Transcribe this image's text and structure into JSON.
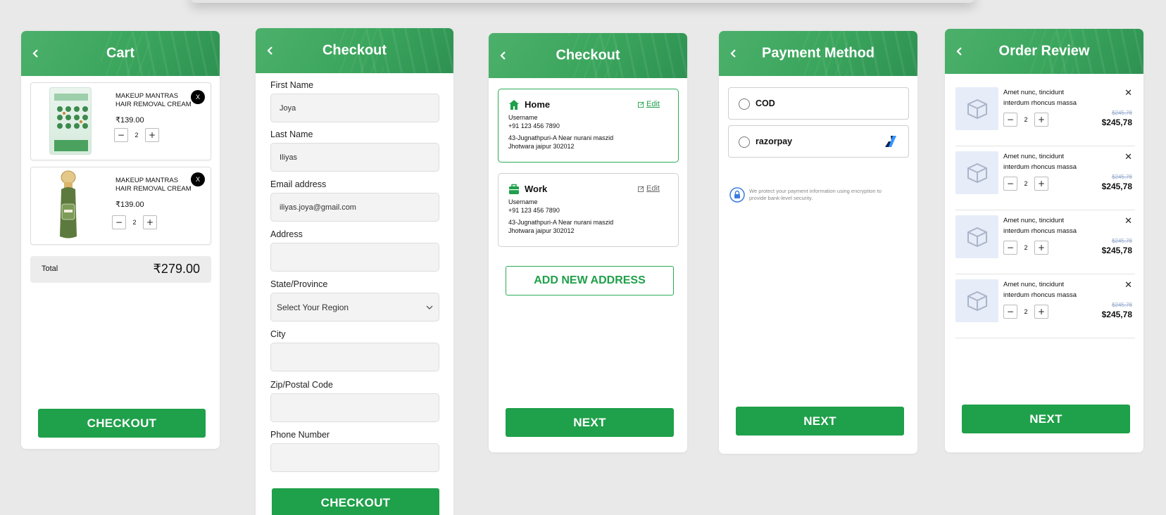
{
  "cart": {
    "title": "Cart",
    "items": [
      {
        "name_line1": "MAKEUP MANTRAS",
        "name_line2": "HAIR REMOVAL CREAM",
        "price": "₹139.00",
        "qty": "2",
        "remove": "X"
      },
      {
        "name_line1": "MAKEUP MANTRAS",
        "name_line2": "HAIR REMOVAL CREAM",
        "price": "₹139.00",
        "qty": "2",
        "remove": "X"
      }
    ],
    "total_label": "Total",
    "total_value": "₹279.00",
    "checkout_label": "CHECKOUT"
  },
  "checkout_form": {
    "title": "Checkout",
    "fields": {
      "first_name": {
        "label": "First Name",
        "value": "Joya"
      },
      "last_name": {
        "label": "Last Name",
        "value": "Iliyas"
      },
      "email": {
        "label": "Email address",
        "value": "iliyas.joya@gmail.com"
      },
      "address": {
        "label": "Address",
        "value": ""
      },
      "state": {
        "label": "State/Province",
        "value": "Select Your Region"
      },
      "city": {
        "label": "City",
        "value": ""
      },
      "zip": {
        "label": "Zip/Postal Code",
        "value": ""
      },
      "phone": {
        "label": "Phone Number",
        "value": ""
      }
    },
    "checkout_label": "CHECKOUT"
  },
  "address_select": {
    "title": "Checkout",
    "addresses": [
      {
        "label": "Home",
        "edit": "Edit",
        "username": "Username",
        "phone": "+91 123 456 7890",
        "line1": "43-Jugnathpuri-A Near nurani maszid",
        "line2": "Jhotwara jaipur 302012",
        "selected": true
      },
      {
        "label": "Work",
        "edit": "Edit",
        "username": "Username",
        "phone": "+91 123 456 7890",
        "line1": "43-Jugnathpuri-A Near nurani maszid",
        "line2": "Jhotwara jaipur 302012",
        "selected": false
      }
    ],
    "add_new_label": "ADD NEW ADDRESS",
    "next_label": "NEXT"
  },
  "payment": {
    "title": "Payment Method",
    "options": [
      {
        "label": "COD"
      },
      {
        "label": "razorpay"
      }
    ],
    "security_note_line1": "We protect your payment information using encryption to",
    "security_note_line2": "provide bank-level security.",
    "next_label": "NEXT"
  },
  "order_review": {
    "title": "Order Review",
    "items": [
      {
        "name_line1": "Amet nunc, tincidunt",
        "name_line2": "interdum rhoncus massa",
        "qty": "2",
        "old_price": "$245,78",
        "price": "$245,78"
      },
      {
        "name_line1": "Amet nunc, tincidunt",
        "name_line2": "interdum rhoncus massa",
        "qty": "2",
        "old_price": "$245,78",
        "price": "$245,78"
      },
      {
        "name_line1": "Amet nunc, tincidunt",
        "name_line2": "interdum rhoncus massa",
        "qty": "2",
        "old_price": "$245,78",
        "price": "$245,78"
      },
      {
        "name_line1": "Amet nunc, tincidunt",
        "name_line2": "interdum rhoncus massa",
        "qty": "2",
        "old_price": "$245,78",
        "price": "$245,78"
      }
    ],
    "next_label": "NEXT"
  },
  "colors": {
    "primary_green": "#1fa04a",
    "header_green": "#3aa55c",
    "page_bg": "#e9e9e9"
  }
}
